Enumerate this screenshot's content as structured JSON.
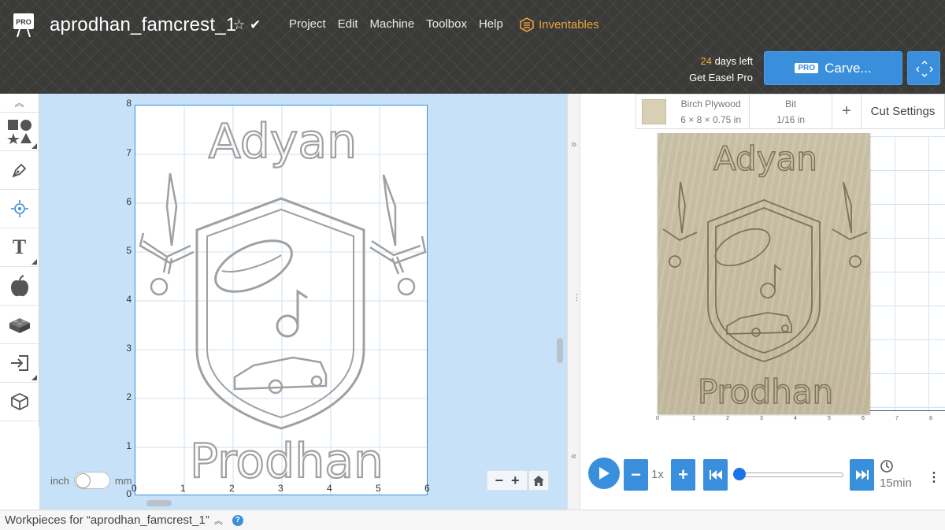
{
  "header": {
    "logo_text": "PRO",
    "project_title": "aprodhan_famcrest_1",
    "star_icon": "star-outline-icon",
    "check_icon": "check-icon",
    "menu": [
      "Project",
      "Edit",
      "Machine",
      "Toolbox",
      "Help"
    ],
    "inventables_label": "Inventables",
    "days_left_number": "24",
    "days_left_suffix": " days left",
    "get_pro_label": "Get Easel Pro",
    "carve_badge": "PRO",
    "carve_label": "Carve...",
    "accent_color": "#3a8fdc",
    "highlight_color": "#e8a33d"
  },
  "toolbar": {
    "tools": [
      "shapes-icon",
      "pen-icon",
      "point-icon",
      "text-icon",
      "apple-icon",
      "lego-block-icon",
      "import-icon",
      "box-3d-icon"
    ]
  },
  "canvas": {
    "y_ticks": [
      "8",
      "7",
      "6",
      "5",
      "4",
      "3",
      "2",
      "1",
      "0"
    ],
    "x_ticks": [
      "0",
      "1",
      "2",
      "3",
      "4",
      "5",
      "6"
    ],
    "design_top_text": "Adyan",
    "design_bottom_text": "Prodhan",
    "unit_inch": "inch",
    "unit_mm": "mm",
    "unit_selected": "inch"
  },
  "preview": {
    "material_name": "Birch Plywood",
    "material_dims": "6 × 8 × 0.75 in",
    "bit_label": "Bit",
    "bit_value": "1/16 in",
    "cut_settings_label": "Cut Settings",
    "carve_top_text": "Adyan",
    "carve_bottom_text": "Prodhan",
    "x_ticks": [
      "0",
      "1",
      "2",
      "3",
      "4",
      "5",
      "6",
      "7",
      "8"
    ],
    "speed": "1x",
    "time_estimate": "15min",
    "playback_progress": 0
  },
  "bottom_bar": {
    "workpieces_label": "Workpieces for “aprodhan_famcrest_1”"
  }
}
